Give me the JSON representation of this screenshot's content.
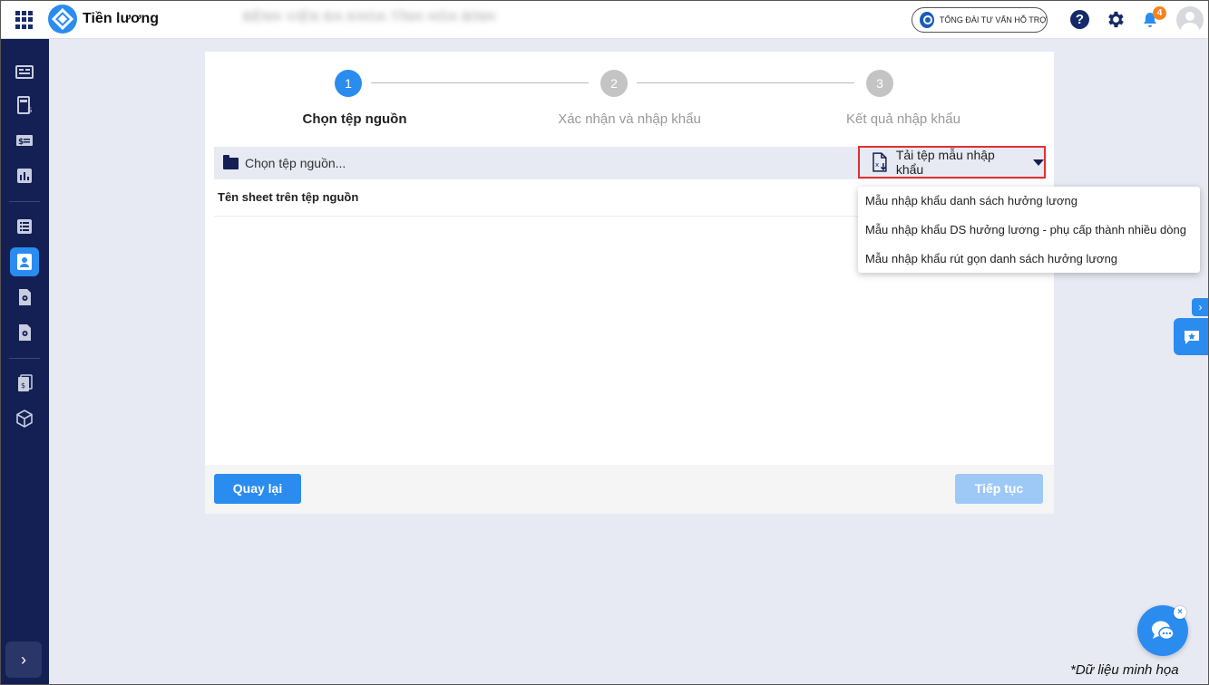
{
  "header": {
    "app_title": "Tiền lương",
    "org_name": "BỆNH VIỆN ĐA KHOA TỈNH HÒA BÌNH",
    "hotline_label": "TỔNG ĐÀI TƯ VẤN HỖ TRỢ",
    "help_label": "?",
    "notification_count": "4",
    "icons": [
      "apps-grid-icon",
      "logo-icon",
      "phone-icon",
      "help-icon",
      "gear-icon",
      "bell-icon",
      "avatar"
    ]
  },
  "sidebar": {
    "items": [
      {
        "name": "dashboard-icon"
      },
      {
        "name": "payroll-calculator-icon"
      },
      {
        "name": "salary-card-icon"
      },
      {
        "name": "report-chart-icon"
      },
      {
        "name": "list-icon"
      },
      {
        "name": "employee-profile-icon",
        "active": true
      },
      {
        "name": "settings-document-icon"
      },
      {
        "name": "config-document-icon"
      },
      {
        "name": "finance-ledger-icon"
      },
      {
        "name": "package-box-icon"
      }
    ],
    "expand_label": "›"
  },
  "steps": [
    {
      "number": "1",
      "label": "Chọn tệp nguồn",
      "active": true
    },
    {
      "number": "2",
      "label": "Xác nhận và nhập khẩu",
      "active": false
    },
    {
      "number": "3",
      "label": "Kết quả nhập khẩu",
      "active": false
    }
  ],
  "file_picker": {
    "placeholder": "Chọn tệp nguồn...",
    "download_template_label": "Tải tệp mẫu nhập khẩu"
  },
  "sheet": {
    "label": "Tên sheet trên tệp nguồn"
  },
  "footer": {
    "back_label": "Quay lại",
    "next_label": "Tiếp tục"
  },
  "dropdown": {
    "items": [
      "Mẫu nhập khẩu danh sách hưởng lương",
      "Mẫu nhập khẩu DS hưởng lương - phụ cấp thành nhiều dòng",
      "Mẫu nhập khẩu rút gọn danh sách hưởng lương"
    ]
  },
  "widgets": {
    "collapse_label": "›",
    "chat_close_label": "×"
  },
  "watermark": "*Dữ liệu minh họa",
  "colors": {
    "primary": "#2b8cf0",
    "sidebar": "#142054",
    "highlight_border": "#e03030",
    "badge": "#f5831f"
  }
}
